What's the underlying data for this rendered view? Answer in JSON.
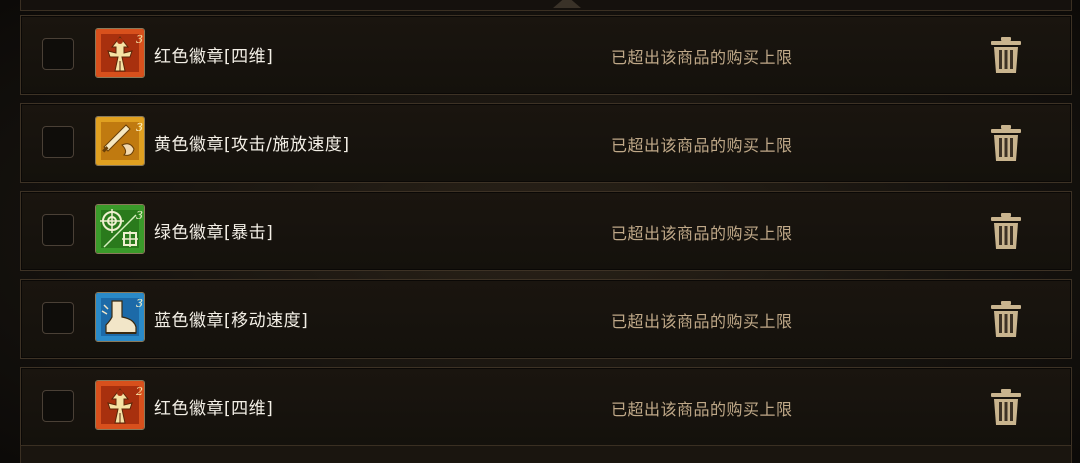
{
  "items": [
    {
      "name": "红色徽章[四维]",
      "status": "已超出该商品的购买上限",
      "icon": "red-badge-stats-icon",
      "level": "3",
      "color": "#d8501c"
    },
    {
      "name": "黄色徽章[攻击/施放速度]",
      "status": "已超出该商品的购买上限",
      "icon": "yellow-badge-speed-icon",
      "level": "3",
      "color": "#e0a020"
    },
    {
      "name": "绿色徽章[暴击]",
      "status": "已超出该商品的购买上限",
      "icon": "green-badge-crit-icon",
      "level": "3",
      "color": "#3a9a2a"
    },
    {
      "name": "蓝色徽章[移动速度]",
      "status": "已超出该商品的购买上限",
      "icon": "blue-badge-move-icon",
      "level": "3",
      "color": "#2a8ac8"
    },
    {
      "name": "红色徽章[四维]",
      "status": "已超出该商品的购买上限",
      "icon": "red-badge-stats-icon",
      "level": "2",
      "color": "#d8501c"
    }
  ],
  "colors": {
    "status_text": "#bfa888",
    "trash": "#c9b48e"
  }
}
